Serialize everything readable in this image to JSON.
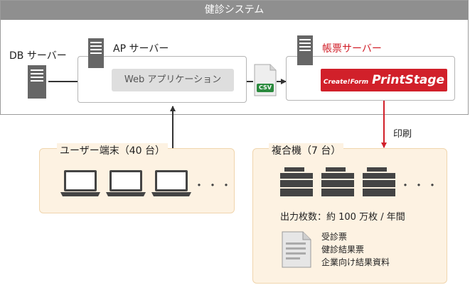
{
  "system": {
    "title": "健診システム"
  },
  "db_server": {
    "label": "DB サーバー"
  },
  "ap_server": {
    "label": "AP サーバー",
    "app_label": "Web アプリケーション"
  },
  "csv_file": {
    "label": "CSV"
  },
  "form_server": {
    "label": "帳票サーバー",
    "logo_small": "Create!Form",
    "logo_big": "PrintStage"
  },
  "print_arrow": {
    "label": "印刷"
  },
  "terminals": {
    "title": "ユーザー端末（40 台）",
    "ellipsis": "・・・"
  },
  "mfp": {
    "title": "複合機（7 台）",
    "ellipsis": "・・・",
    "output": "出力枚数：約 100 万枚 / 年間",
    "documents": [
      "受診票",
      "健診結果票",
      "企業向け結果資料"
    ]
  },
  "colors": {
    "accent_red": "#d1202a",
    "header_gray": "#8f8f8f",
    "panel_bg": "#fdf2e2"
  }
}
